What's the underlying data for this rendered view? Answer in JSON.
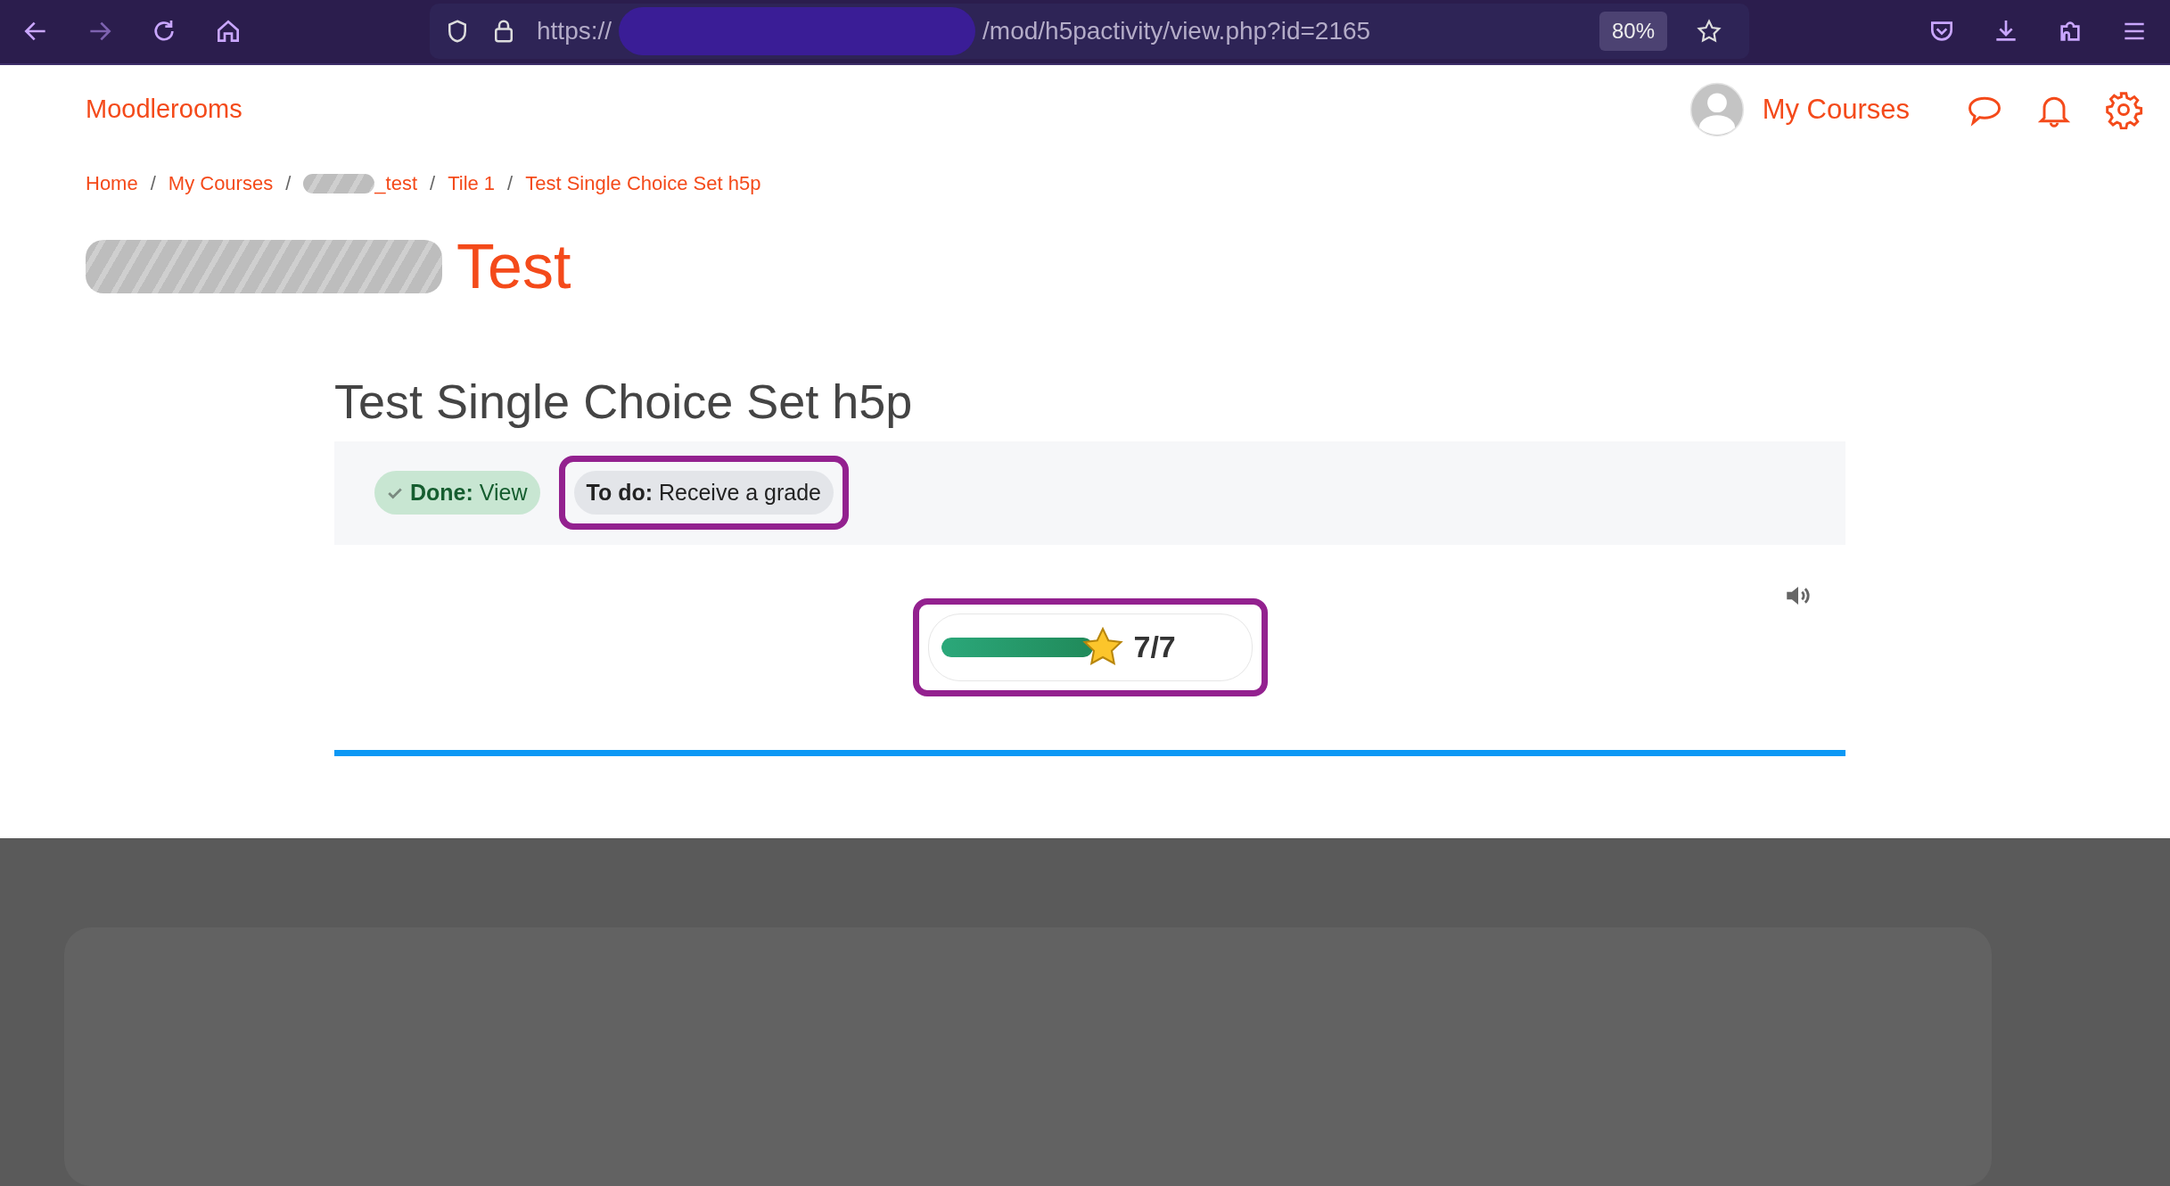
{
  "browser": {
    "url_prefix": "https://",
    "url_path": "/mod/h5pactivity/view.php?id=2165",
    "zoom": "80%"
  },
  "header": {
    "site_name": "Moodlerooms",
    "user_link": "My Courses"
  },
  "breadcrumb": [
    {
      "label": "Home",
      "redacted": false
    },
    {
      "separator": "/",
      "label": "My Courses",
      "redacted": false
    },
    {
      "separator": "/",
      "label": "_test",
      "redacted": true
    },
    {
      "separator": "/",
      "label": "Tile 1",
      "redacted": false
    },
    {
      "separator": "/",
      "label": "Test Single Choice Set h5p",
      "redacted": false
    }
  ],
  "course_title": {
    "text": "Test",
    "redacted": true
  },
  "activity": {
    "title": "Test Single Choice Set h5p",
    "completion": [
      {
        "kind": "done",
        "label": "Done:",
        "text": "View",
        "highlighted": false
      },
      {
        "kind": "todo",
        "label": "To do:",
        "text": "Receive a grade",
        "highlighted": true
      }
    ],
    "score": {
      "level": 1,
      "text": "7/7",
      "highlighted": true
    }
  }
}
